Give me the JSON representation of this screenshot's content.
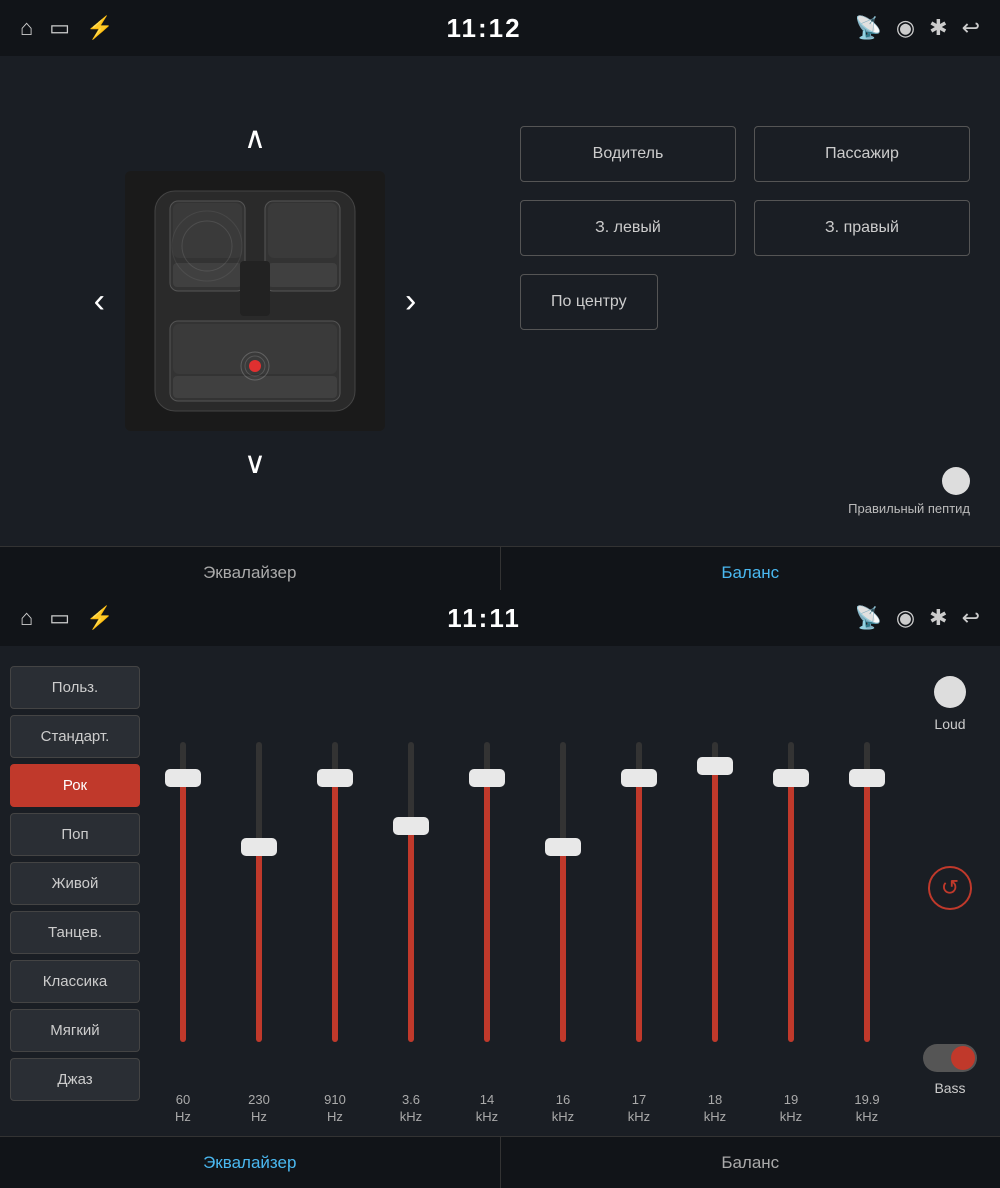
{
  "top": {
    "statusBar": {
      "time": "11:12",
      "icons_left": [
        "home-icon",
        "screen-icon",
        "usb-icon"
      ],
      "icons_right": [
        "cast-icon",
        "location-icon",
        "bluetooth-icon",
        "back-icon"
      ]
    },
    "tabs": {
      "equalizer": "Эквалайзер",
      "balance": "Баланс",
      "active": "balance"
    },
    "zones": {
      "driver": "Водитель",
      "passenger": "Пассажир",
      "rearLeft": "З. левый",
      "rearRight": "З. правый",
      "center": "По центру"
    },
    "indicator": {
      "text": "Правильный пептид"
    }
  },
  "bottom": {
    "statusBar": {
      "time": "11:11"
    },
    "tabs": {
      "equalizer": "Эквалайзер",
      "balance": "Баланс",
      "active": "equalizer"
    },
    "presets": [
      {
        "id": "polz",
        "label": "Польз.",
        "active": false
      },
      {
        "id": "standart",
        "label": "Стандарт.",
        "active": false
      },
      {
        "id": "rok",
        "label": "Рок",
        "active": true
      },
      {
        "id": "pop",
        "label": "Поп",
        "active": false
      },
      {
        "id": "zhivoy",
        "label": "Живой",
        "active": false
      },
      {
        "id": "tantsev",
        "label": "Танцев.",
        "active": false
      },
      {
        "id": "klassika",
        "label": "Классика",
        "active": false
      },
      {
        "id": "myagkiy",
        "label": "Мягкий",
        "active": false
      },
      {
        "id": "dzhaz",
        "label": "Джаз",
        "active": false
      }
    ],
    "sliders": [
      {
        "freq": "60",
        "unit": "Hz",
        "fillPercent": 88
      },
      {
        "freq": "230",
        "unit": "Hz",
        "fillPercent": 65
      },
      {
        "freq": "910",
        "unit": "Hz",
        "fillPercent": 88
      },
      {
        "freq": "3.6",
        "unit": "kHz",
        "fillPercent": 72
      },
      {
        "freq": "14",
        "unit": "kHz",
        "fillPercent": 88
      },
      {
        "freq": "16",
        "unit": "kHz",
        "fillPercent": 65
      },
      {
        "freq": "17",
        "unit": "kHz",
        "fillPercent": 88
      },
      {
        "freq": "18",
        "unit": "kHz",
        "fillPercent": 92
      },
      {
        "freq": "19",
        "unit": "kHz",
        "fillPercent": 88
      },
      {
        "freq": "19.9",
        "unit": "kHz",
        "fillPercent": 88
      }
    ],
    "controls": {
      "loud": "Loud",
      "bass": "Bass",
      "reset": "↺"
    }
  }
}
